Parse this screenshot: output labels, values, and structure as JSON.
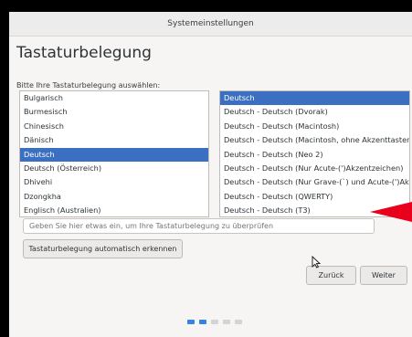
{
  "window": {
    "title": "Systemeinstellungen"
  },
  "page": {
    "title": "Tastaturbelegung",
    "prompt": "Bitte Ihre Tastaturbelegung auswählen:"
  },
  "languages": [
    {
      "label": "Bulgarisch",
      "selected": false
    },
    {
      "label": "Burmesisch",
      "selected": false
    },
    {
      "label": "Chinesisch",
      "selected": false
    },
    {
      "label": "Dänisch",
      "selected": false
    },
    {
      "label": "Deutsch",
      "selected": true
    },
    {
      "label": "Deutsch (Österreich)",
      "selected": false
    },
    {
      "label": "Dhivehi",
      "selected": false
    },
    {
      "label": "Dzongkha",
      "selected": false
    },
    {
      "label": "Englisch (Australien)",
      "selected": false
    }
  ],
  "variants": [
    {
      "label": "Deutsch",
      "selected": true
    },
    {
      "label": "Deutsch - Deutsch (Dvorak)",
      "selected": false
    },
    {
      "label": "Deutsch - Deutsch (Macintosh)",
      "selected": false
    },
    {
      "label": "Deutsch - Deutsch (Macintosh, ohne Akzenttasten)",
      "selected": false
    },
    {
      "label": "Deutsch - Deutsch (Neo 2)",
      "selected": false
    },
    {
      "label": "Deutsch - Deutsch (Nur Acute-(')Akzentzeichen)",
      "selected": false
    },
    {
      "label": "Deutsch - Deutsch (Nur Grave-(`) und Acute-(')Akzen",
      "selected": false
    },
    {
      "label": "Deutsch - Deutsch (QWERTY)",
      "selected": false
    },
    {
      "label": "Deutsch - Deutsch (T3)",
      "selected": false
    }
  ],
  "test_input": {
    "value": "",
    "placeholder": "Geben Sie hier etwas ein, um Ihre Tastaturbelegung zu überprüfen"
  },
  "buttons": {
    "detect": "Tastaturbelegung automatisch erkennen",
    "back": "Zurück",
    "next": "Weiter"
  },
  "progress": {
    "steps": 5,
    "current": 2
  },
  "colors": {
    "accent": "#3584e4",
    "selection": "#3a6fc2",
    "annotation_arrow": "#e8001c"
  },
  "icons": {
    "cursor": "arrow-pointer-icon",
    "annotation": "red-arrow-icon"
  }
}
